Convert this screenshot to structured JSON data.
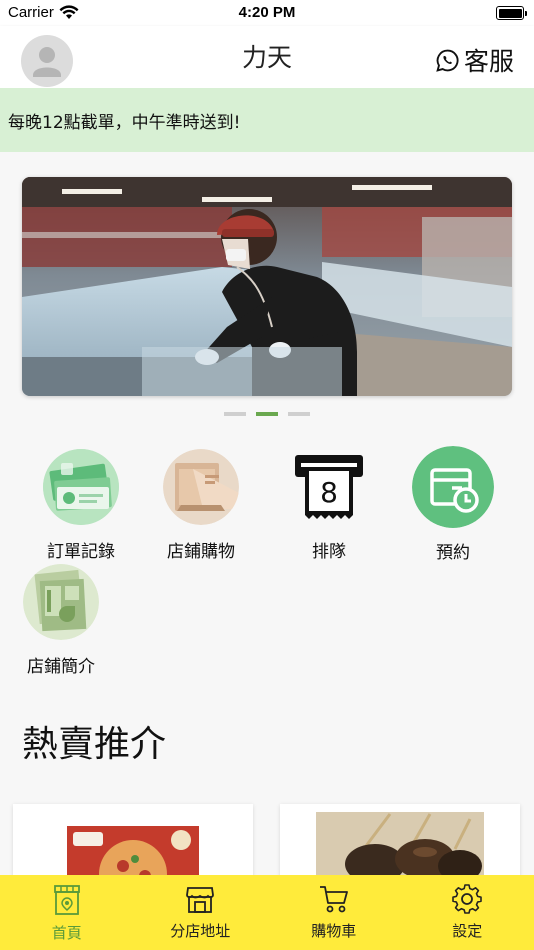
{
  "status": {
    "carrier": "Carrier",
    "time": "4:20 PM"
  },
  "header": {
    "title": "力天",
    "cs_label": "客服"
  },
  "notice": {
    "text": "每晚12點截單，中午準時送到!"
  },
  "banner": {
    "slide_count": 3,
    "active_slide": 2
  },
  "menu": {
    "items": [
      {
        "label": "訂單記錄",
        "icon": "order-history-icon"
      },
      {
        "label": "店鋪購物",
        "icon": "shop-shopping-icon"
      },
      {
        "label": "排隊",
        "icon": "queue-ticket-icon"
      },
      {
        "label": "預約",
        "icon": "reservation-icon"
      },
      {
        "label": "店鋪簡介",
        "icon": "shop-intro-icon"
      }
    ]
  },
  "section": {
    "title": "熱賣推介"
  },
  "tabs": [
    {
      "label": "首頁",
      "icon": "home-store-icon",
      "active": true
    },
    {
      "label": "分店地址",
      "icon": "branch-store-icon",
      "active": false
    },
    {
      "label": "購物車",
      "icon": "cart-icon",
      "active": false
    },
    {
      "label": "設定",
      "icon": "gear-icon",
      "active": false
    }
  ],
  "colors": {
    "notice_bg": "#d8f0d4",
    "tabbar_bg": "#ffeb3b",
    "active_tab": "#5a9a3a",
    "active_dot": "#6aa84f"
  }
}
